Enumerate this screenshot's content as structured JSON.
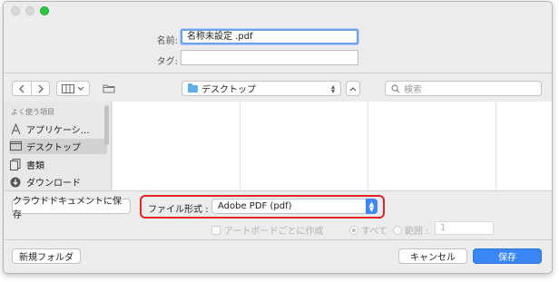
{
  "window": {
    "lights": [
      "gray",
      "gray",
      "green"
    ]
  },
  "save": {
    "name_label": "名前:",
    "name_value": "名称未設定 .pdf",
    "tags_label": "タグ:",
    "tags_value": ""
  },
  "toolbar": {
    "back_icon": "chevron-left-icon",
    "forward_icon": "chevron-right-icon",
    "view_icon": "column-view-icon",
    "new_folder_icon": "folder-icon",
    "location": "デスクトップ",
    "search_placeholder": "検索"
  },
  "sidebar": {
    "header": "よく使う項目",
    "items": [
      {
        "label": "アプリケーシ…",
        "icon": "applications-icon"
      },
      {
        "label": "デスクトップ",
        "icon": "desktop-icon",
        "selected": true
      },
      {
        "label": "書類",
        "icon": "documents-icon"
      },
      {
        "label": "ダウンロード",
        "icon": "download-icon"
      }
    ]
  },
  "options": {
    "cloud_button": "クラウドドキュメントに保存",
    "format_label": "ファイル形式 :",
    "format_value": "Adobe PDF (pdf)",
    "artboard_checkbox": "アートボードごとに作成",
    "radio_all": "すべて",
    "radio_range": "範囲 :",
    "range_value": "1"
  },
  "footer": {
    "new_folder": "新規フォルダ",
    "cancel": "キャンセル",
    "save": "保存"
  },
  "colors": {
    "accent": "#3a86f5",
    "highlight": "#e0242a"
  }
}
